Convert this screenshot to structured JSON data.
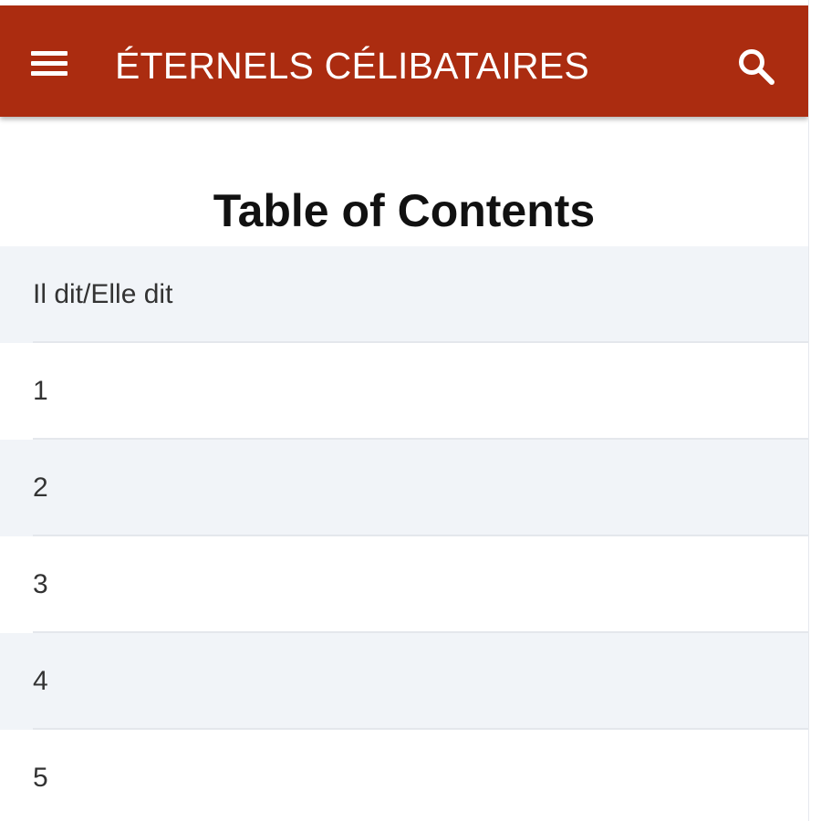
{
  "app_bar": {
    "title": "ÉTERNELS CÉLIBATAIRES",
    "menu_icon": "hamburger-menu-icon",
    "search_icon": "search-icon",
    "background_color": "#ab2c10",
    "text_color": "#ffffff"
  },
  "page": {
    "title": "Table of Contents"
  },
  "toc": {
    "items": [
      {
        "label": "Il dit/Elle dit"
      },
      {
        "label": "1"
      },
      {
        "label": "2"
      },
      {
        "label": "3"
      },
      {
        "label": "4"
      },
      {
        "label": "5"
      }
    ]
  }
}
